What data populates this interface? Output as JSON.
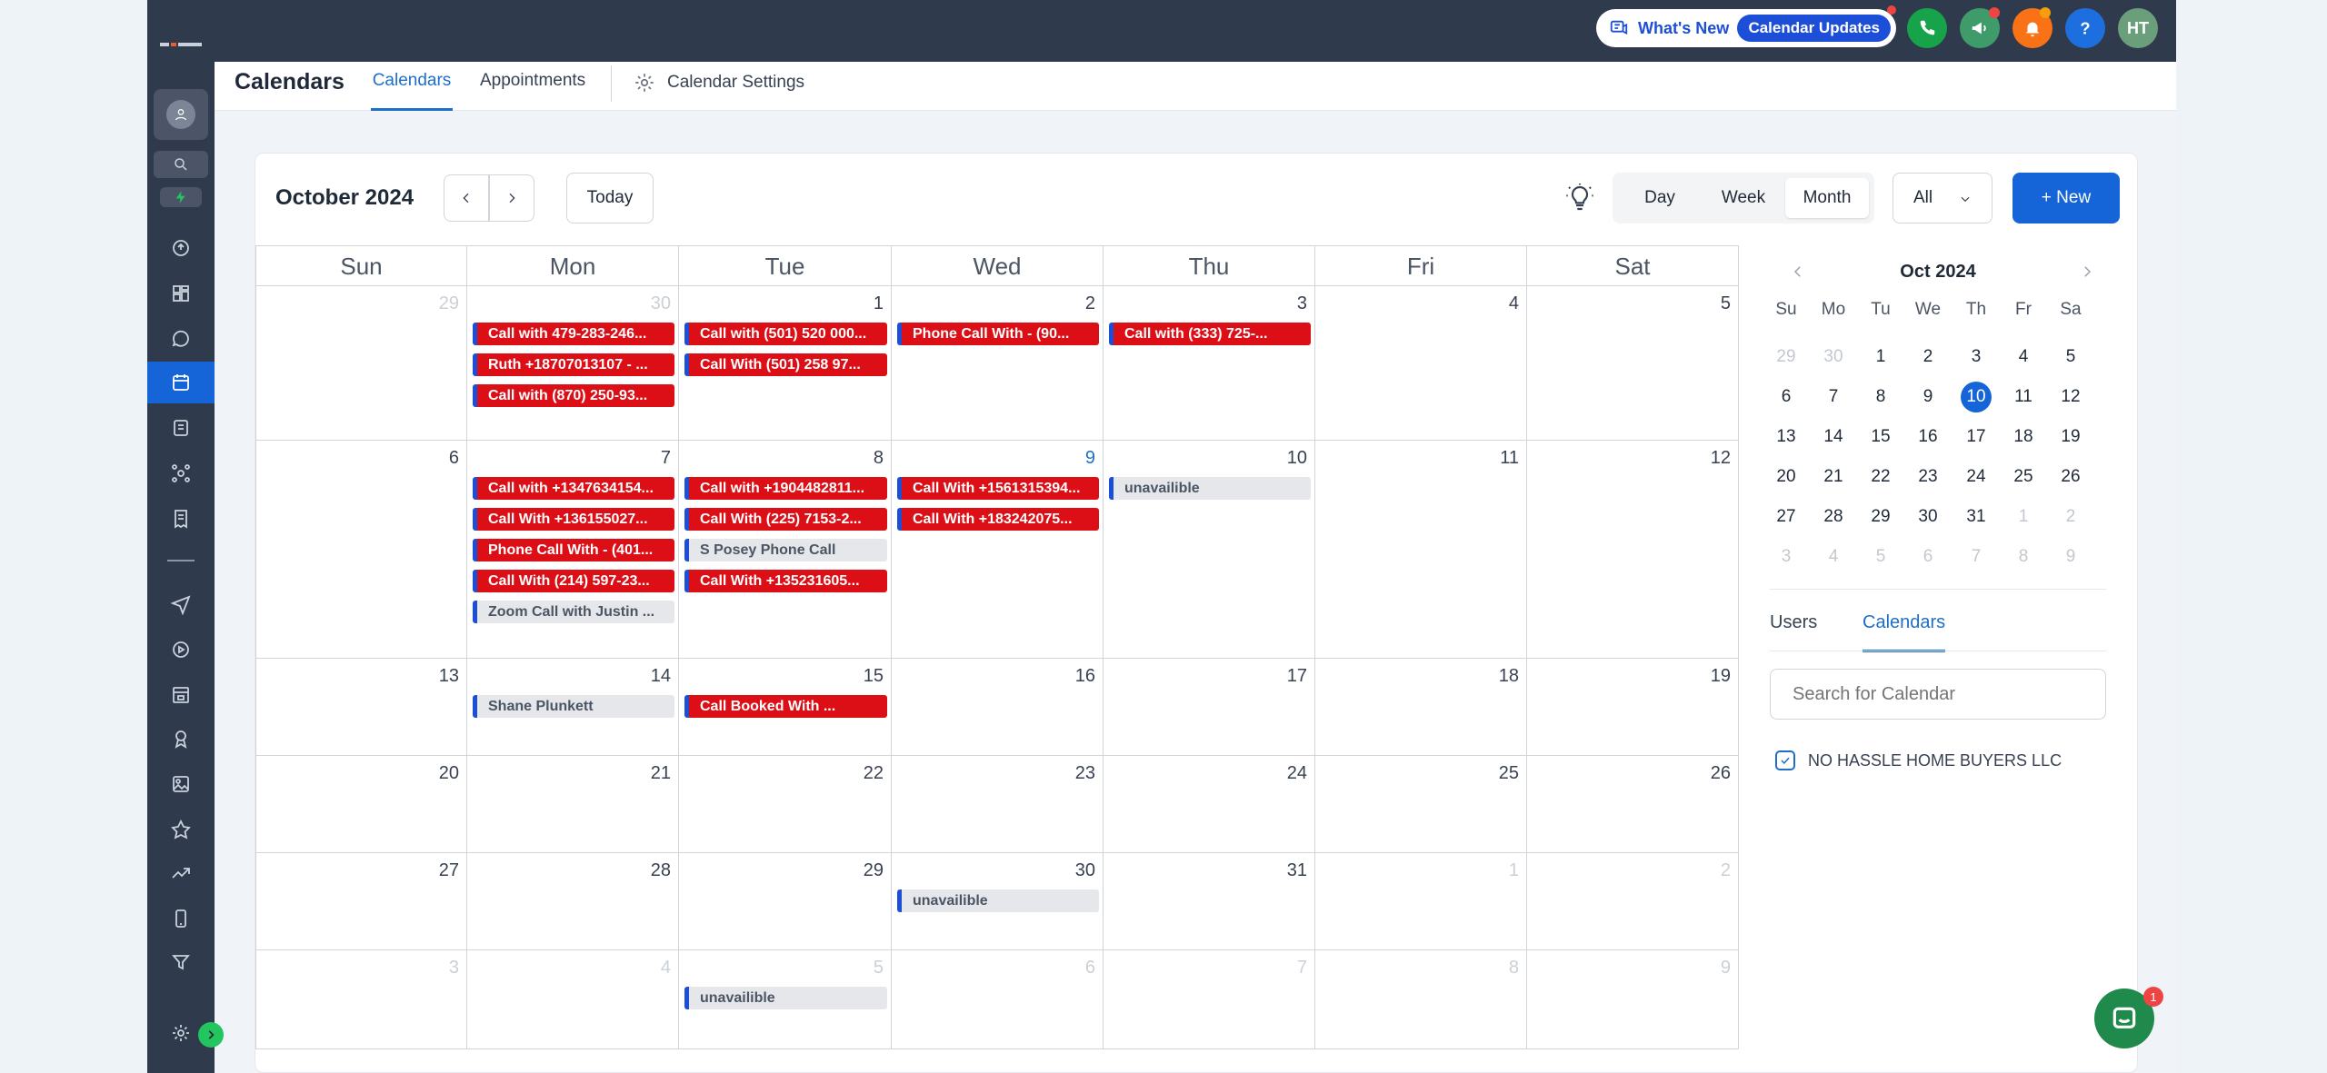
{
  "topbar": {
    "whats_new": "What's New",
    "calendar_updates": "Calendar Updates",
    "avatar_initials": "HT"
  },
  "subnav": {
    "title": "Calendars",
    "tabs": [
      "Calendars",
      "Appointments"
    ],
    "settings": "Calendar Settings"
  },
  "toolbar": {
    "month_title": "October 2024",
    "today": "Today",
    "views": [
      "Day",
      "Week",
      "Month"
    ],
    "active_view": "Month",
    "filter": "All",
    "new_label": "+ New"
  },
  "grid": {
    "weekdays": [
      "Sun",
      "Mon",
      "Tue",
      "Wed",
      "Thu",
      "Fri",
      "Sat"
    ],
    "weeks": [
      [
        {
          "d": "29",
          "muted": true,
          "events": []
        },
        {
          "d": "30",
          "muted": true,
          "events": [
            {
              "t": "Call with 479-283-246...",
              "c": "red"
            },
            {
              "t": "Ruth +18707013107 - ...",
              "c": "red"
            },
            {
              "t": "Call with (870) 250-93...",
              "c": "red"
            }
          ]
        },
        {
          "d": "1",
          "events": [
            {
              "t": "Call with (501) 520 000...",
              "c": "red"
            },
            {
              "t": "Call With  (501) 258 97...",
              "c": "red"
            }
          ]
        },
        {
          "d": "2",
          "events": [
            {
              "t": "Phone Call With   - (90...",
              "c": "red"
            }
          ]
        },
        {
          "d": "3",
          "events": [
            {
              "t": "Call with (333) 725-...",
              "c": "red"
            }
          ]
        },
        {
          "d": "4",
          "events": []
        },
        {
          "d": "5",
          "events": []
        }
      ],
      [
        {
          "d": "6",
          "events": []
        },
        {
          "d": "7",
          "events": [
            {
              "t": "Call with  +1347634154...",
              "c": "red"
            },
            {
              "t": "Call With  +136155027...",
              "c": "red"
            },
            {
              "t": "Phone Call With   - (401...",
              "c": "red"
            },
            {
              "t": "Call With (214) 597-23...",
              "c": "red"
            },
            {
              "t": "Zoom Call with Justin ...",
              "c": "gray"
            }
          ]
        },
        {
          "d": "8",
          "events": [
            {
              "t": "Call with  +1904482811...",
              "c": "red"
            },
            {
              "t": "Call With (225) 7153-2...",
              "c": "red"
            },
            {
              "t": "S Posey Phone Call",
              "c": "gray"
            },
            {
              "t": "Call With  +135231605...",
              "c": "red"
            }
          ]
        },
        {
          "d": "9",
          "today": true,
          "events": [
            {
              "t": "Call With  +1561315394...",
              "c": "red"
            },
            {
              "t": "Call With  +183242075...",
              "c": "red"
            }
          ]
        },
        {
          "d": "10",
          "events": [
            {
              "t": "unavailible",
              "c": "gray"
            }
          ]
        },
        {
          "d": "11",
          "events": []
        },
        {
          "d": "12",
          "events": []
        }
      ],
      [
        {
          "d": "13",
          "events": []
        },
        {
          "d": "14",
          "events": [
            {
              "t": "Shane Plunkett",
              "c": "gray"
            }
          ]
        },
        {
          "d": "15",
          "events": [
            {
              "t": "Call Booked With  ...",
              "c": "red"
            }
          ]
        },
        {
          "d": "16",
          "events": []
        },
        {
          "d": "17",
          "events": []
        },
        {
          "d": "18",
          "events": []
        },
        {
          "d": "19",
          "events": []
        }
      ],
      [
        {
          "d": "20",
          "events": []
        },
        {
          "d": "21",
          "events": []
        },
        {
          "d": "22",
          "events": []
        },
        {
          "d": "23",
          "events": []
        },
        {
          "d": "24",
          "events": []
        },
        {
          "d": "25",
          "events": []
        },
        {
          "d": "26",
          "events": []
        }
      ],
      [
        {
          "d": "27",
          "events": []
        },
        {
          "d": "28",
          "events": []
        },
        {
          "d": "29",
          "events": []
        },
        {
          "d": "30",
          "events": [
            {
              "t": "unavailible",
              "c": "gray"
            }
          ]
        },
        {
          "d": "31",
          "events": []
        },
        {
          "d": "1",
          "muted": true,
          "events": []
        },
        {
          "d": "2",
          "muted": true,
          "events": []
        }
      ],
      [
        {
          "d": "3",
          "muted": true,
          "events": []
        },
        {
          "d": "4",
          "muted": true,
          "events": []
        },
        {
          "d": "5",
          "muted": true,
          "events": [
            {
              "t": "unavailible",
              "c": "gray"
            }
          ]
        },
        {
          "d": "6",
          "muted": true,
          "events": []
        },
        {
          "d": "7",
          "muted": true,
          "events": []
        },
        {
          "d": "8",
          "muted": true,
          "events": []
        },
        {
          "d": "9",
          "muted": true,
          "events": []
        }
      ]
    ]
  },
  "mini": {
    "title": "Oct 2024",
    "weekdays": [
      "Su",
      "Mo",
      "Tu",
      "We",
      "Th",
      "Fr",
      "Sa"
    ],
    "days": [
      [
        "29",
        "30",
        "1",
        "2",
        "3",
        "4",
        "5"
      ],
      [
        "6",
        "7",
        "8",
        "9",
        "10",
        "11",
        "12"
      ],
      [
        "13",
        "14",
        "15",
        "16",
        "17",
        "18",
        "19"
      ],
      [
        "20",
        "21",
        "22",
        "23",
        "24",
        "25",
        "26"
      ],
      [
        "27",
        "28",
        "29",
        "30",
        "31",
        "1",
        "2"
      ],
      [
        "3",
        "4",
        "5",
        "6",
        "7",
        "8",
        "9"
      ]
    ],
    "selected": "10",
    "tabs": [
      "Users",
      "Calendars"
    ],
    "search_placeholder": "Search for Calendar",
    "calendar_name": "NO HASSLE HOME BUYERS LLC"
  },
  "chat": {
    "badge": "1"
  },
  "colors": {
    "brand": "#1565d8",
    "event_red": "#dc0f17",
    "sidebar": "#2f3a4c"
  }
}
